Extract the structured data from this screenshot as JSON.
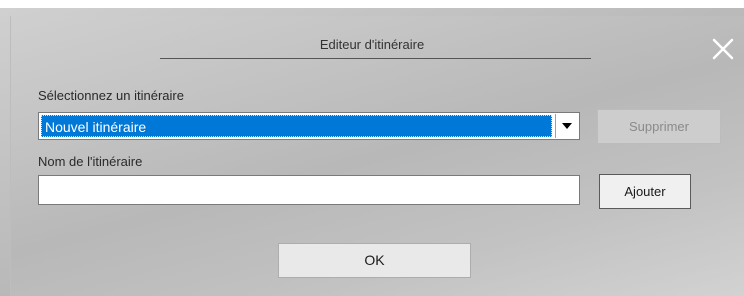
{
  "dialog": {
    "title": "Editeur d'itinéraire",
    "close_icon": "close-icon"
  },
  "route_select": {
    "label": "Sélectionnez un itinéraire",
    "selected_value": "Nouvel itinéraire",
    "dropdown_icon": "chevron-down-icon"
  },
  "route_name": {
    "label": "Nom de l'itinéraire",
    "value": "",
    "placeholder": ""
  },
  "buttons": {
    "delete_label": "Supprimer",
    "add_label": "Ajouter",
    "ok_label": "OK"
  },
  "colors": {
    "selection": "#0078d7",
    "dialog_background": "#c4c4c4",
    "disabled_text": "#8a8a8a"
  }
}
